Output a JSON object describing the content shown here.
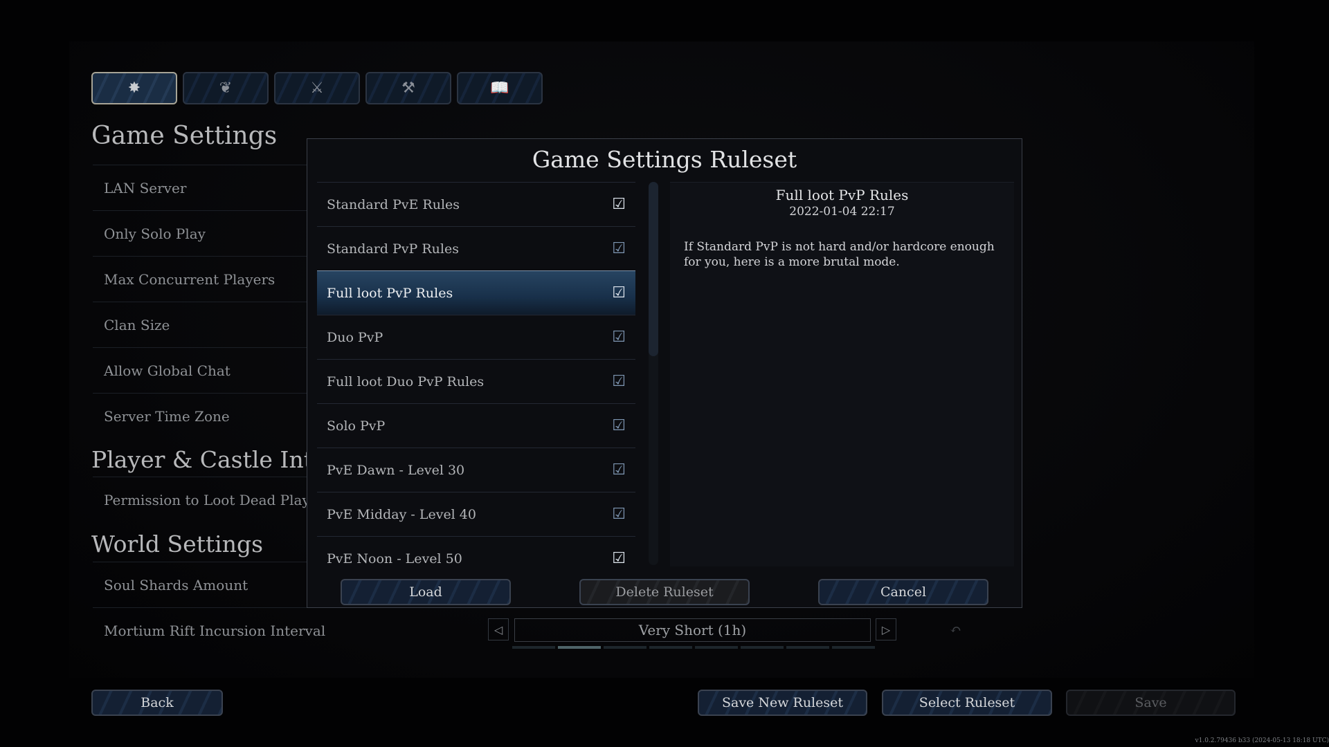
{
  "tabs": [
    {
      "icon": "gear-icon",
      "glyph": "✸",
      "active": true
    },
    {
      "icon": "blood-potion-icon",
      "glyph": "❦"
    },
    {
      "icon": "crossed-swords-icon",
      "glyph": "⚔"
    },
    {
      "icon": "hammer-icon",
      "glyph": "⚒"
    },
    {
      "icon": "book-icon",
      "glyph": "📖"
    }
  ],
  "settings": {
    "title": "Game Settings",
    "items": [
      "LAN Server",
      "Only Solo Play",
      "Max Concurrent Players",
      "Clan Size",
      "Allow Global Chat",
      "Server Time Zone"
    ],
    "section2": "Player & Castle Intera",
    "items2": [
      "Permission to Loot Dead Players"
    ],
    "section3": "World Settings",
    "items3": [
      "Soul Shards Amount",
      "Mortium Rift Incursion Interval"
    ],
    "mortium": {
      "value": "Very Short (1h)",
      "segments": 8,
      "selected_index": 1
    }
  },
  "modal": {
    "title": "Game Settings Ruleset",
    "rulesets": [
      "Standard PvE Rules",
      "Standard PvP Rules",
      "Full loot PvP Rules",
      "Duo PvP",
      "Full loot Duo PvP Rules",
      "Solo PvP",
      "PvE Dawn - Level 30",
      "PvE Midday - Level 40",
      "PvE Noon - Level 50"
    ],
    "selected_index": 2,
    "detail": {
      "name": "Full loot PvP Rules",
      "date": "2022-01-04 22:17",
      "description": "If Standard PvP is not hard and/or hardcore enough for you, here is a more brutal mode."
    },
    "load": "Load",
    "delete": "Delete Ruleset",
    "cancel": "Cancel"
  },
  "footer": {
    "back": "Back",
    "save_new": "Save New Ruleset",
    "select": "Select Ruleset",
    "save": "Save"
  },
  "version": "v1.0.2.79436 b33 (2024-05-13 18:18 UTC)"
}
